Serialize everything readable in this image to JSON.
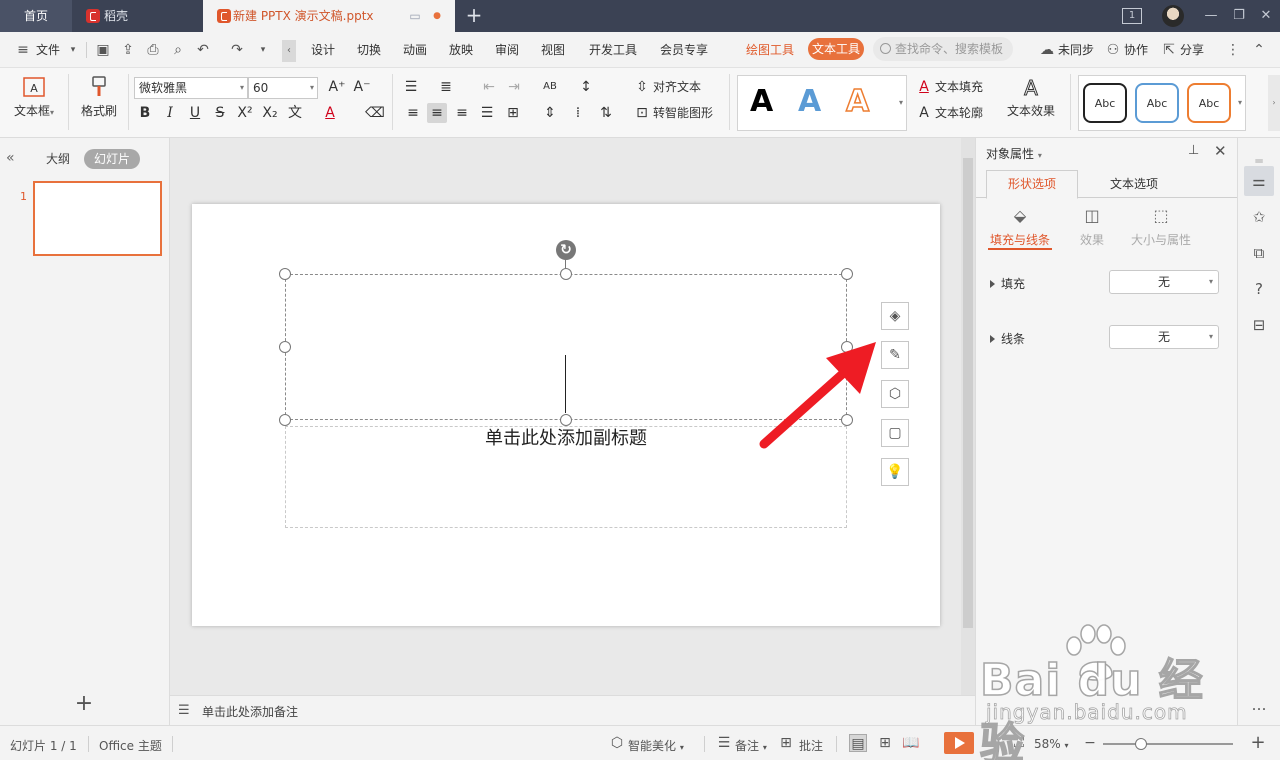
{
  "tabs": {
    "home": "首页",
    "daoke": "稻壳",
    "document": "新建 PPTX 演示文稿.pptx"
  },
  "window": {
    "page_counter": "1"
  },
  "menu": {
    "file": "文件",
    "design": "设计",
    "transition": "切换",
    "animation": "动画",
    "slideshow": "放映",
    "review": "审阅",
    "view": "视图",
    "developer": "开发工具",
    "member": "会员专享",
    "drawing_tool": "绘图工具",
    "text_tool": "文本工具",
    "search_placeholder": "查找命令、搜索模板",
    "sync": "未同步",
    "collaborate": "协作",
    "share": "分享"
  },
  "ribbon": {
    "textbox": "文本框",
    "format_painter": "格式刷",
    "font_name": "微软雅黑",
    "font_size": "60",
    "align_text": "对齐文本",
    "smartart": "转智能图形",
    "text_fill": "文本填充",
    "text_outline": "文本轮廓",
    "text_effect": "文本效果",
    "wordart_samples": [
      "A",
      "A",
      "A"
    ],
    "style_samples": [
      "Abc",
      "Abc",
      "Abc"
    ]
  },
  "left_panel": {
    "outline": "大纲",
    "slides": "幻灯片",
    "slide_number": "1"
  },
  "slide": {
    "subtitle_placeholder": "单击此处添加副标题"
  },
  "notes": {
    "placeholder": "单击此处添加备注"
  },
  "property_panel": {
    "title": "对象属性",
    "tabs": [
      "形状选项",
      "文本选项"
    ],
    "subtabs": [
      "填充与线条",
      "效果",
      "大小与属性"
    ],
    "fill_label": "填充",
    "fill_value": "无",
    "line_label": "线条",
    "line_value": "无"
  },
  "status": {
    "slide_info": "幻灯片 1 / 1",
    "theme": "Office 主题",
    "beautify": "智能美化",
    "notes": "备注",
    "comments": "批注",
    "zoom": "58%",
    "zoom_fraction": 0.29
  },
  "watermark": {
    "brand": "Bai du 经验",
    "url": "jingyan.baidu.com"
  },
  "colors": {
    "accent": "#e8713c",
    "tabbar": "#3b4254",
    "arrow": "#ee1c24"
  }
}
